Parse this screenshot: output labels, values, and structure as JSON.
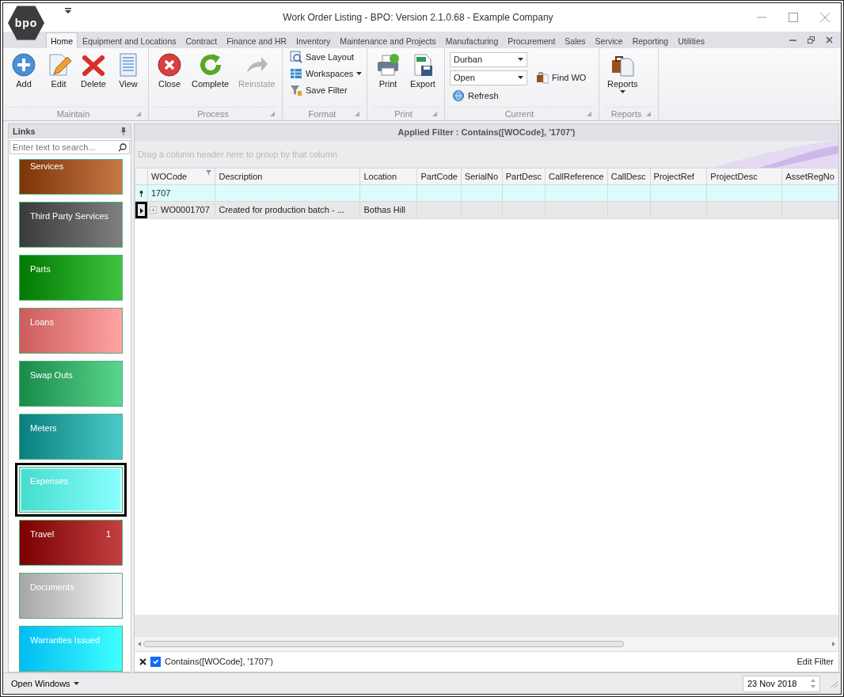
{
  "window": {
    "title": "Work Order Listing - BPO: Version 2.1.0.68 - Example Company",
    "logo": "bpo"
  },
  "ribbon_tabs": [
    {
      "label": "Home",
      "selected": true
    },
    {
      "label": "Equipment and Locations",
      "selected": false
    },
    {
      "label": "Contract",
      "selected": false
    },
    {
      "label": "Finance and HR",
      "selected": false
    },
    {
      "label": "Inventory",
      "selected": false
    },
    {
      "label": "Maintenance and Projects",
      "selected": false
    },
    {
      "label": "Manufacturing",
      "selected": false
    },
    {
      "label": "Procurement",
      "selected": false
    },
    {
      "label": "Sales",
      "selected": false
    },
    {
      "label": "Service",
      "selected": false
    },
    {
      "label": "Reporting",
      "selected": false
    },
    {
      "label": "Utilities",
      "selected": false
    }
  ],
  "ribbon_groups": [
    {
      "label": "Maintain",
      "kind": "large",
      "items": [
        {
          "kind": "large",
          "label": "Add",
          "disabled": false,
          "menu": false
        },
        {
          "kind": "large",
          "label": "Edit",
          "disabled": false,
          "menu": false
        },
        {
          "kind": "large",
          "label": "Delete",
          "disabled": false,
          "menu": false
        },
        {
          "kind": "large",
          "label": "View",
          "disabled": false,
          "menu": false
        }
      ]
    },
    {
      "label": "Process",
      "kind": "large",
      "items": [
        {
          "kind": "large",
          "label": "Close",
          "disabled": false,
          "menu": false
        },
        {
          "kind": "large",
          "label": "Complete",
          "disabled": false,
          "menu": false
        },
        {
          "kind": "large",
          "label": "Reinstate",
          "disabled": true,
          "menu": false
        }
      ]
    },
    {
      "label": "Format",
      "kind": "stack",
      "items": [
        {
          "kind": "small",
          "label": "Save Layout",
          "disabled": false,
          "menu": false
        },
        {
          "kind": "small",
          "label": "Workspaces",
          "disabled": false,
          "menu": true
        },
        {
          "kind": "small",
          "label": "Save Filter",
          "disabled": false,
          "menu": false
        }
      ]
    },
    {
      "label": "Print",
      "kind": "large",
      "items": [
        {
          "kind": "large",
          "label": "Print",
          "disabled": false,
          "menu": false
        },
        {
          "kind": "large",
          "label": "Export",
          "disabled": false,
          "menu": false
        }
      ]
    },
    {
      "label": "Current",
      "kind": "current",
      "items": [
        {
          "kind": "combo",
          "value": "Durban"
        },
        {
          "kind": "combo",
          "value": "Open"
        },
        {
          "kind": "small",
          "label": "Find WO",
          "disabled": false,
          "menu": false
        },
        {
          "kind": "small",
          "label": "Refresh",
          "disabled": false,
          "menu": false
        }
      ]
    },
    {
      "label": "Reports",
      "kind": "large",
      "items": [
        {
          "kind": "large",
          "label": "Reports",
          "disabled": false,
          "menu": true
        }
      ]
    }
  ],
  "links": {
    "title": "Links",
    "search": {
      "placeholder": "Enter text to search..."
    },
    "tiles": [
      {
        "label": "Services",
        "color": "#7c3406",
        "selected": false
      },
      {
        "label": "Third Party Services",
        "color": "#3a3a3a",
        "selected": false
      },
      {
        "label": "Parts",
        "color": "#007a00",
        "selected": false
      },
      {
        "label": "Loans",
        "color": "#cc5c5c",
        "selected": false
      },
      {
        "label": "Swap Outs",
        "color": "#188a48",
        "selected": false
      },
      {
        "label": "Meters",
        "color": "#0a7f7f",
        "selected": false
      },
      {
        "label": "Expenses",
        "color": "#44dccc",
        "selected": true
      },
      {
        "label": "Travel",
        "color": "#7a0000",
        "selected": false,
        "badge": "1"
      },
      {
        "label": "Documents",
        "color": "#a6a6a6",
        "selected": false
      },
      {
        "label": "Warranties Issued",
        "color": "#00bcf4",
        "selected": false
      }
    ]
  },
  "grid": {
    "applied_filter": "Applied Filter : Contains([WOCode], '1707')",
    "group_panel_hint": "Drag a column header here to group by that column",
    "columns": [
      {
        "label": "WOCode",
        "filtered": true,
        "filter_value": "1707"
      },
      {
        "label": "Description",
        "filtered": false
      },
      {
        "label": "Location",
        "filtered": false
      },
      {
        "label": "PartCode",
        "filtered": false
      },
      {
        "label": "SerialNo",
        "filtered": false
      },
      {
        "label": "PartDesc",
        "filtered": false
      },
      {
        "label": "CallReference",
        "filtered": false
      },
      {
        "label": "CallDesc",
        "filtered": false
      },
      {
        "label": "ProjectRef",
        "filtered": false
      },
      {
        "label": "ProjectDesc",
        "filtered": false
      },
      {
        "label": "AssetRegNo",
        "filtered": false
      }
    ],
    "rows": [
      {
        "selected": true,
        "expandable": true,
        "cells": [
          "WO0001707",
          "Created for production batch - ...",
          "Bothas Hill"
        ]
      }
    ],
    "filter_bar": {
      "enabled": true,
      "text": "Contains([WOCode], '1707')",
      "edit_label": "Edit Filter"
    }
  },
  "status_bar": {
    "open_windows": "Open Windows",
    "date": "23 Nov 2018"
  }
}
